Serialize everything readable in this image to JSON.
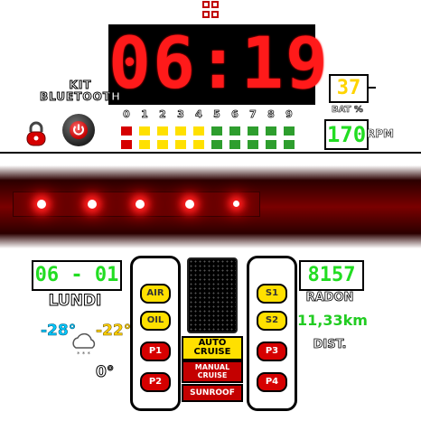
{
  "clock": {
    "time": "06:19"
  },
  "kit": {
    "title_line1": "KIT",
    "title_line2": "BLUETOOTH"
  },
  "rpm_bars": {
    "labels": [
      "0",
      "1",
      "2",
      "3",
      "4",
      "5",
      "6",
      "7",
      "8",
      "9"
    ],
    "colors": [
      "#d60000",
      "#ffe000",
      "#ffe000",
      "#ffe000",
      "#ffe000",
      "#2e9e2e",
      "#2e9e2e",
      "#2e9e2e",
      "#2e9e2e",
      "#2e9e2e"
    ]
  },
  "battery": {
    "value": "37",
    "label": "BAT %"
  },
  "rpm": {
    "value": "170",
    "label": "RPM"
  },
  "date": {
    "value": "06 - 01",
    "day": "LUNDI"
  },
  "weather": {
    "temp_left": "-28°",
    "temp_right": "-22°",
    "temp_bottom": "0°",
    "cloud_icon": "snow-cloud-icon"
  },
  "left_buttons": [
    "AIR",
    "OIL",
    "P1",
    "P2"
  ],
  "right_buttons": [
    "S1",
    "S2",
    "P3",
    "P4"
  ],
  "center_buttons": {
    "auto_cruise": "AUTO\nCRUISE",
    "manual_cruise": "MANUAL\nCRUISE",
    "sunroof": "SUNROOF"
  },
  "odometer": {
    "value": "8157",
    "label": "RADON"
  },
  "distance": {
    "value": "11,33km",
    "label": "DIST."
  },
  "colors": {
    "segment_red": "#ff1a1a",
    "digit_green": "#22dd22",
    "digit_yellow": "#ffd400"
  }
}
